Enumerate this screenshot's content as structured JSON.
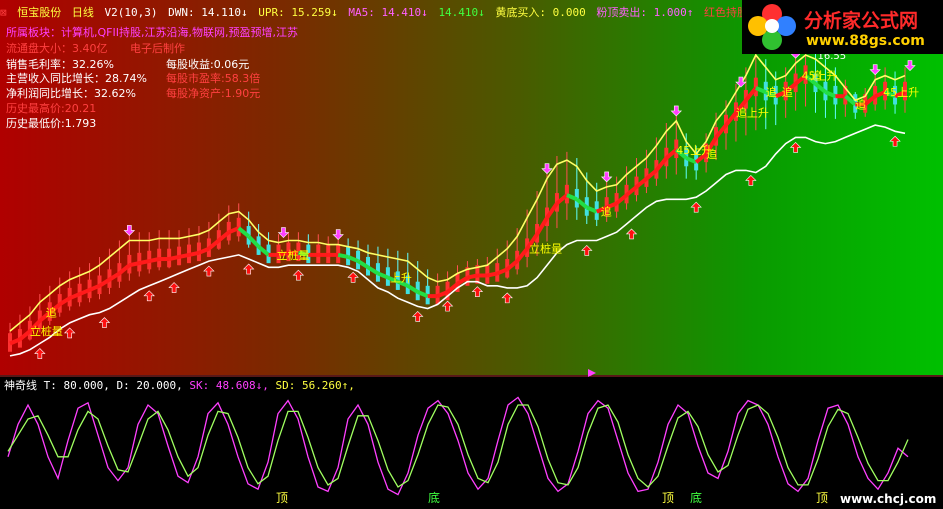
{
  "header": {
    "stock_name": "恒宝股份",
    "period": "日线",
    "indicator": "V2(10,3)",
    "dwn": "DWN: 14.110↓",
    "upr": "UPR: 15.259↓",
    "ma5": "MA5: 14.410↓",
    "ma5b": "14.410↓",
    "buy": "黄底买入: 0.000",
    "sell": "粉顶卖出: 1.000↑",
    "hold": "红色持股: 0.0"
  },
  "info": {
    "sector": "所属板块：计算机,QFII持股,江苏沿海,物联网,预盈预增,江苏",
    "float_cap": "流通盘大小：3.40亿",
    "industry": "电子后制作",
    "gross_margin": "销售毛利率：32.26%",
    "eps": "每股收益:0.06元",
    "revenue_growth": "主营收入同比增长：28.74%",
    "pe": "每股市盈率:58.3倍",
    "profit_growth": "净利润同比增长：32.62%",
    "nav": "每股净资产:1.90元",
    "hist_high": "历史最高价:20.21",
    "hist_low": "历史最低价:1.793"
  },
  "logo": {
    "text": "分析家公式网",
    "url": "www.88gs.com"
  },
  "indicator_header": {
    "name": "神奇线",
    "t": "T: 80.000,",
    "d": "D: 20.000,",
    "sk": "SK: 48.608↓,",
    "sd": "SD: 56.260↑,"
  },
  "watermark": "www.chcj.com",
  "colors": {
    "yellow_band": "#ffff66",
    "white_band": "#ffffff",
    "trend_up": "#ff1a1a",
    "trend_down": "#22dd44",
    "sk_line": "#ff40ff",
    "sd_line": "#a0ff60",
    "label_yellow": "#ffff00",
    "arrow_red": "#ff1010",
    "arrow_magenta": "#ff40ff"
  },
  "chart_data": [
    {
      "type": "line",
      "chart": "main",
      "price_range": [
        1.8,
        16.6
      ],
      "x": [
        0,
        10,
        20,
        30,
        40,
        50,
        60,
        70,
        80,
        90,
        100,
        110,
        120,
        130,
        140,
        150,
        160,
        170,
        180,
        190,
        200,
        210,
        220,
        230,
        240,
        250,
        260,
        270,
        280,
        290,
        300,
        310,
        320,
        330,
        340,
        350,
        360,
        370,
        380,
        390,
        400,
        410,
        420,
        430,
        440,
        450,
        460,
        470,
        480,
        490,
        500,
        510,
        520,
        530,
        540,
        550,
        560,
        570,
        580,
        590,
        600,
        610,
        620,
        630,
        640,
        650,
        660,
        670,
        680,
        690,
        700,
        710,
        720,
        730,
        740,
        750,
        760,
        770,
        780,
        790,
        800,
        810,
        820,
        830,
        840,
        850,
        860,
        870,
        880,
        890,
        900
      ],
      "series": [
        {
          "name": "upper",
          "values": [
            3.2,
            3.6,
            4.0,
            4.6,
            5.0,
            5.4,
            5.7,
            5.9,
            6.1,
            6.4,
            6.8,
            7.2,
            7.6,
            7.6,
            7.6,
            7.7,
            7.7,
            7.7,
            7.8,
            7.9,
            8.1,
            8.5,
            8.9,
            9.0,
            8.6,
            8.0,
            7.6,
            7.5,
            7.6,
            7.6,
            7.5,
            7.5,
            7.4,
            7.4,
            7.3,
            7.2,
            7.0,
            6.9,
            6.8,
            6.7,
            6.6,
            6.2,
            5.8,
            5.6,
            5.7,
            6.0,
            6.2,
            6.3,
            6.4,
            6.8,
            7.2,
            7.8,
            8.7,
            9.6,
            10.6,
            11.3,
            11.5,
            11.2,
            10.5,
            10.0,
            10.2,
            10.3,
            10.8,
            11.2,
            11.6,
            12.2,
            12.9,
            13.4,
            12.4,
            11.8,
            12.4,
            13.4,
            14.0,
            14.8,
            15.6,
            16.6,
            16.0,
            15.4,
            15.6,
            16.2,
            16.6,
            16.4,
            16.0,
            15.6,
            15.0,
            14.4,
            14.6,
            15.4,
            15.6,
            15.4,
            15.6
          ]
        },
        {
          "name": "lower",
          "values": [
            2.0,
            2.1,
            2.3,
            2.6,
            2.9,
            3.3,
            3.6,
            3.8,
            4.0,
            4.1,
            4.3,
            4.6,
            4.9,
            5.2,
            5.4,
            5.6,
            5.8,
            6.0,
            6.2,
            6.4,
            6.6,
            6.7,
            6.8,
            6.9,
            6.7,
            6.5,
            6.3,
            6.3,
            6.4,
            6.4,
            6.4,
            6.4,
            6.4,
            6.4,
            6.3,
            6.1,
            5.7,
            5.3,
            5.1,
            4.8,
            4.6,
            4.4,
            4.3,
            4.5,
            4.9,
            5.3,
            5.6,
            5.6,
            5.4,
            5.4,
            5.3,
            5.3,
            5.4,
            5.8,
            6.4,
            7.0,
            7.4,
            7.6,
            7.6,
            7.6,
            7.8,
            8.0,
            8.4,
            8.8,
            9.2,
            9.5,
            9.6,
            9.6,
            9.6,
            9.7,
            10.0,
            10.4,
            10.8,
            11.0,
            11.0,
            10.9,
            11.2,
            11.8,
            12.3,
            12.6,
            12.6,
            12.4,
            12.3,
            12.4,
            12.6,
            12.8,
            13.0,
            13.2,
            13.1,
            12.9,
            12.8
          ]
        },
        {
          "name": "trend",
          "values": [
            2.6,
            2.8,
            3.2,
            3.7,
            4.1,
            4.5,
            4.8,
            5.0,
            5.2,
            5.4,
            5.7,
            6.0,
            6.4,
            6.5,
            6.6,
            6.7,
            6.7,
            6.8,
            6.9,
            7.0,
            7.2,
            7.6,
            8.0,
            8.2,
            7.8,
            7.3,
            6.9,
            6.9,
            7.0,
            7.0,
            6.9,
            6.9,
            6.9,
            6.9,
            6.8,
            6.6,
            6.3,
            6.0,
            5.8,
            5.6,
            5.4,
            5.1,
            4.9,
            4.9,
            5.1,
            5.5,
            5.8,
            5.9,
            5.9,
            6.0,
            6.2,
            6.6,
            7.2,
            7.9,
            8.7,
            9.4,
            9.8,
            9.6,
            9.2,
            9.0,
            9.2,
            9.4,
            9.8,
            10.2,
            10.6,
            11.0,
            11.6,
            12.0,
            11.6,
            11.4,
            11.8,
            12.6,
            13.2,
            13.8,
            14.4,
            15.0,
            14.8,
            14.6,
            14.8,
            15.2,
            15.6,
            15.2,
            14.8,
            14.6,
            14.6,
            14.2,
            14.2,
            14.6,
            14.8,
            14.6,
            14.8
          ]
        }
      ],
      "markers": [
        {
          "x": 36,
          "text": "追"
        },
        {
          "x": 268,
          "text": "立桩量"
        },
        {
          "x": 382,
          "text": "上升"
        },
        {
          "x": 522,
          "text": "立桩量"
        },
        {
          "x": 594,
          "text": "追"
        },
        {
          "x": 670,
          "text": "45上升"
        },
        {
          "x": 700,
          "text": "追"
        },
        {
          "x": 730,
          "text": "追上升"
        },
        {
          "x": 760,
          "text": "追"
        },
        {
          "x": 776,
          "text": "追"
        },
        {
          "x": 796,
          "text": "45上升"
        },
        {
          "x": 805,
          "text": "追"
        },
        {
          "x": 850,
          "text": "追"
        },
        {
          "x": 878,
          "text": "45上升"
        },
        {
          "x": 20,
          "text": "立桩量"
        }
      ],
      "peak_label": "16.55",
      "up_arrows": [
        30,
        60,
        95,
        140,
        165,
        200,
        240,
        290,
        345,
        410,
        440,
        470,
        500,
        580,
        625,
        690,
        745,
        790,
        890
      ],
      "down_arrows": [
        120,
        275,
        330,
        540,
        600,
        670,
        735,
        790,
        815,
        870,
        905
      ]
    },
    {
      "type": "line",
      "chart": "indicator",
      "name": "神奇线",
      "ylim": [
        0,
        100
      ],
      "x": [
        8,
        18,
        28,
        38,
        48,
        58,
        68,
        78,
        88,
        98,
        108,
        118,
        128,
        138,
        148,
        158,
        168,
        178,
        188,
        198,
        208,
        218,
        228,
        238,
        248,
        258,
        268,
        278,
        288,
        298,
        308,
        318,
        328,
        338,
        348,
        358,
        368,
        378,
        388,
        398,
        408,
        418,
        428,
        438,
        448,
        458,
        468,
        478,
        488,
        498,
        508,
        518,
        528,
        538,
        548,
        558,
        568,
        578,
        588,
        598,
        608,
        618,
        628,
        638,
        648,
        658,
        668,
        678,
        688,
        698,
        708,
        718,
        728,
        738,
        748,
        758,
        768,
        778,
        788,
        798,
        808,
        818,
        828,
        838,
        848,
        858,
        868,
        878,
        888,
        898,
        908
      ],
      "series": [
        {
          "name": "SK",
          "values": [
            40,
            70,
            88,
            70,
            40,
            20,
            55,
            85,
            90,
            60,
            30,
            18,
            30,
            70,
            88,
            80,
            50,
            22,
            16,
            40,
            80,
            90,
            70,
            40,
            15,
            10,
            35,
            80,
            92,
            75,
            40,
            12,
            8,
            30,
            75,
            88,
            70,
            35,
            10,
            5,
            25,
            60,
            85,
            92,
            80,
            55,
            25,
            10,
            20,
            55,
            88,
            95,
            80,
            50,
            20,
            8,
            15,
            45,
            80,
            92,
            85,
            55,
            25,
            8,
            10,
            35,
            70,
            88,
            80,
            50,
            25,
            20,
            45,
            80,
            92,
            88,
            70,
            40,
            15,
            8,
            20,
            55,
            85,
            88,
            70,
            40,
            20,
            10,
            25,
            48,
            40
          ]
        },
        {
          "name": "SD",
          "values": [
            45,
            60,
            75,
            78,
            60,
            40,
            40,
            65,
            82,
            75,
            50,
            28,
            26,
            50,
            75,
            82,
            65,
            40,
            22,
            30,
            60,
            82,
            80,
            58,
            30,
            15,
            22,
            55,
            82,
            82,
            58,
            30,
            14,
            20,
            50,
            78,
            78,
            55,
            28,
            12,
            18,
            42,
            70,
            88,
            86,
            70,
            42,
            20,
            16,
            35,
            70,
            88,
            88,
            68,
            38,
            16,
            14,
            30,
            62,
            85,
            88,
            72,
            42,
            20,
            12,
            22,
            50,
            76,
            82,
            68,
            42,
            26,
            32,
            60,
            84,
            88,
            80,
            58,
            30,
            14,
            14,
            38,
            68,
            84,
            80,
            58,
            34,
            18,
            18,
            35,
            56
          ]
        }
      ],
      "labels": [
        {
          "x": 276,
          "text": "顶"
        },
        {
          "x": 428,
          "text": "底"
        },
        {
          "x": 662,
          "text": "顶"
        },
        {
          "x": 690,
          "text": "底"
        },
        {
          "x": 816,
          "text": "顶"
        }
      ]
    }
  ]
}
